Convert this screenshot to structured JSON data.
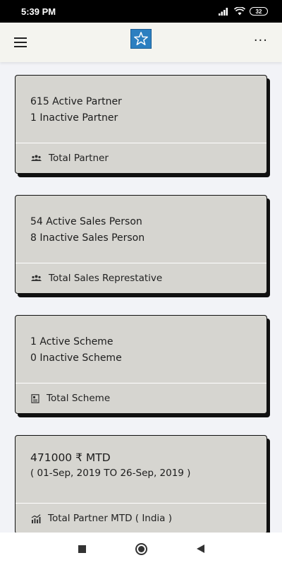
{
  "status_bar": {
    "time": "5:39 PM",
    "battery": "32"
  },
  "cards": [
    {
      "lines": [
        "615 Active Partner",
        "1 Inactive Partner"
      ],
      "footer": "Total Partner",
      "icon": "group-icon"
    },
    {
      "lines": [
        "54 Active Sales Person",
        "8 Inactive Sales Person"
      ],
      "footer": "Total Sales Represtative",
      "icon": "group-icon"
    },
    {
      "lines": [
        "1 Active Scheme",
        "0 Inactive Scheme"
      ],
      "footer": "Total Scheme",
      "icon": "document-icon"
    },
    {
      "amount": "471000 ₹ MTD",
      "period": "( 01-Sep, 2019 TO 26-Sep, 2019 )",
      "footer": "Total Partner MTD ( India )",
      "icon": "chart-icon"
    }
  ],
  "colors": {
    "card_bg": "#d6d5d0",
    "app_bar_bg": "#f4f4ef",
    "page_bg": "#f2f3f7",
    "logo_blue": "#2c7fc0"
  }
}
